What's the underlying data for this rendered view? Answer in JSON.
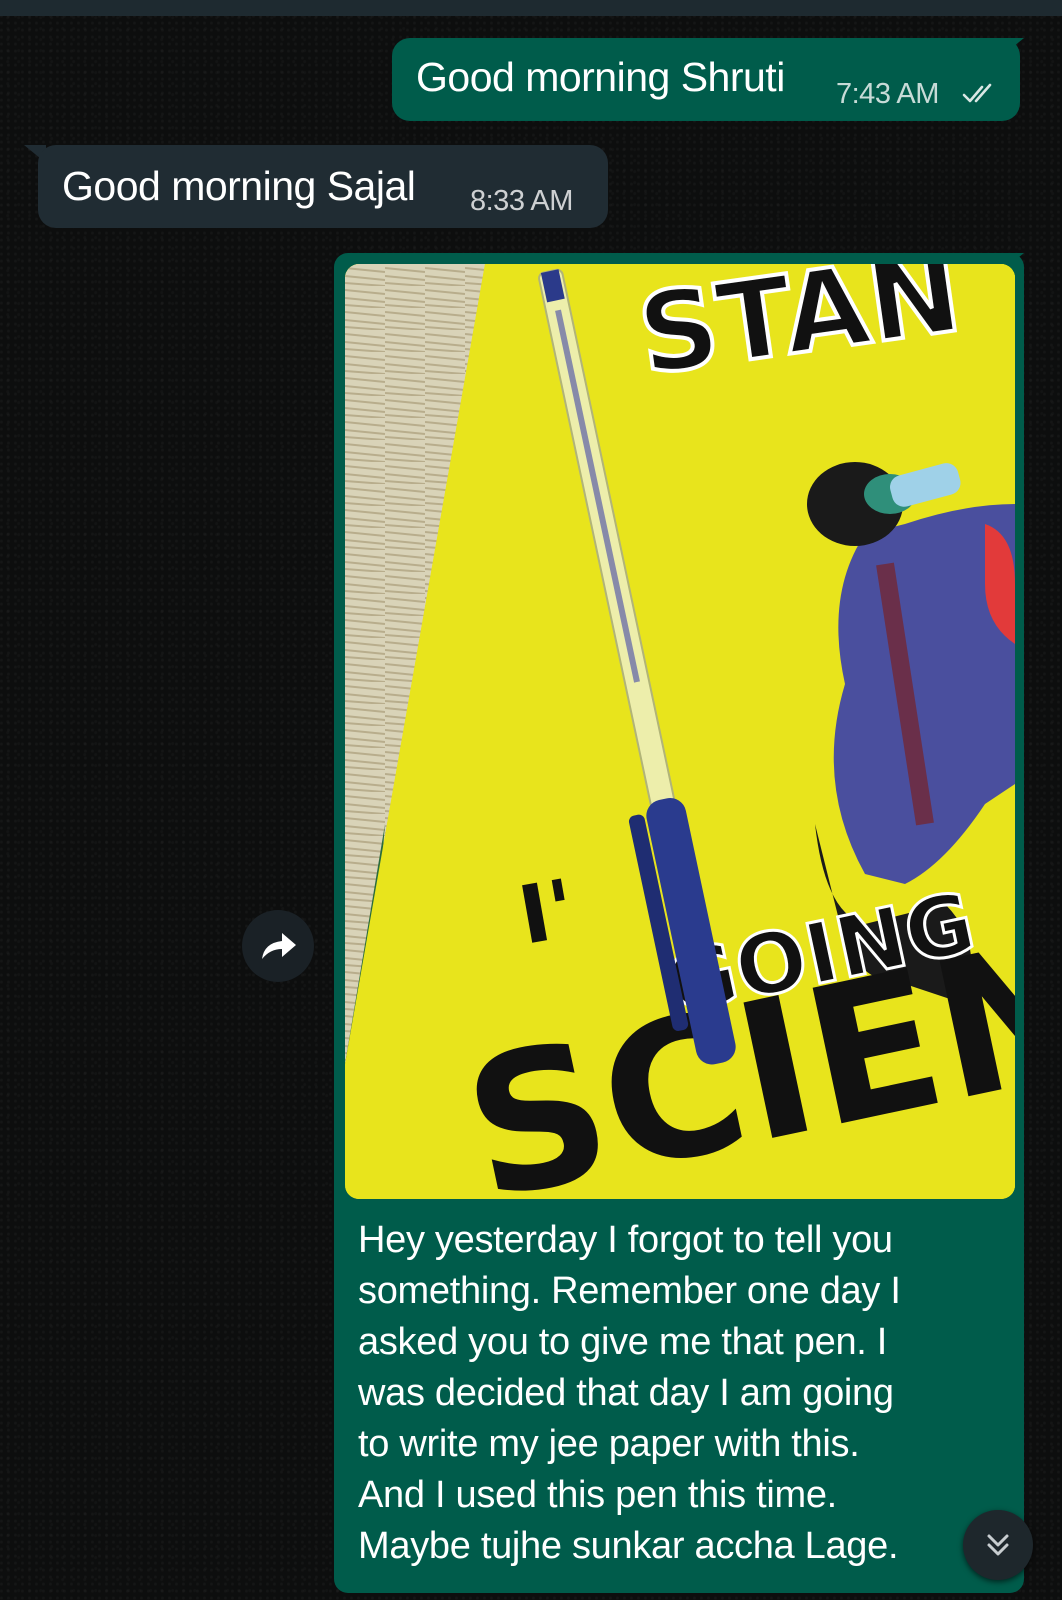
{
  "chat": {
    "messages": [
      {
        "direction": "outgoing",
        "text": "Good morning Shruti",
        "time": "7:43 AM",
        "status": "read"
      },
      {
        "direction": "incoming",
        "text": "Good morning Sajal",
        "time": "8:33 AM"
      },
      {
        "direction": "outgoing",
        "type": "image",
        "photo_text": {
          "top": "STAN",
          "middle_left": "I'",
          "middle_right": "GOING",
          "bottom": "SCIEN"
        },
        "caption_lines": [
          "Hey yesterday I forgot to tell you",
          "something. Remember one day I",
          "asked you to give me that pen. I",
          "was decided that day I am going",
          "to write my jee paper with this.",
          "And I used this pen this time.",
          "Maybe tujhe sunkar accha Lage."
        ]
      }
    ]
  },
  "icons": {
    "forward": "forward-arrow-icon",
    "scroll_down": "double-chevron-down-icon",
    "read_receipt": "double-check-icon"
  },
  "colors": {
    "background": "#0c0d0d",
    "outgoing_bubble": "#005c4b",
    "incoming_bubble": "#202c33",
    "read_tick": "#ffffff"
  }
}
